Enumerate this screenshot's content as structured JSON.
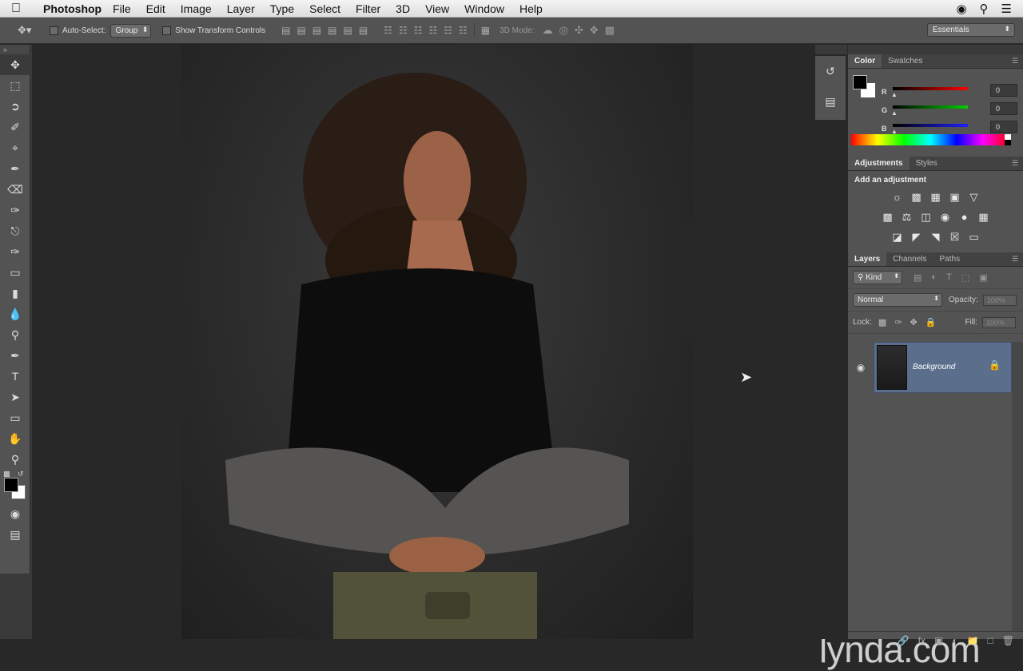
{
  "menubar": {
    "apple": "",
    "app_name": "Photoshop",
    "items": [
      "File",
      "Edit",
      "Image",
      "Layer",
      "Type",
      "Select",
      "Filter",
      "3D",
      "View",
      "Window",
      "Help"
    ],
    "right_icons": [
      "creative-cloud-icon",
      "spotlight-search-icon",
      "notification-list-icon"
    ]
  },
  "options": {
    "auto_select_label": "Auto-Select:",
    "auto_select_value": "Group",
    "transform_label": "Show Transform Controls",
    "mode_3d_label": "3D Mode:",
    "workspace": "Essentials"
  },
  "color_panel": {
    "tabs": [
      "Color",
      "Swatches"
    ],
    "sliders": [
      {
        "label": "R",
        "value": "0",
        "color": "#ff0000"
      },
      {
        "label": "G",
        "value": "0",
        "color": "#00d000"
      },
      {
        "label": "B",
        "value": "0",
        "color": "#2020ff"
      }
    ]
  },
  "adjustments_panel": {
    "tabs": [
      "Adjustments",
      "Styles"
    ],
    "title": "Add an adjustment"
  },
  "layers_panel": {
    "tabs": [
      "Layers",
      "Channels",
      "Paths"
    ],
    "kind_filter": "Kind",
    "blend_mode": "Normal",
    "opacity_label": "Opacity:",
    "opacity_value": "100%",
    "lock_label": "Lock:",
    "fill_label": "Fill:",
    "fill_value": "100%",
    "layers": [
      {
        "name": "Background",
        "visible": true,
        "locked": true
      }
    ]
  },
  "watermark": "lynda.com"
}
